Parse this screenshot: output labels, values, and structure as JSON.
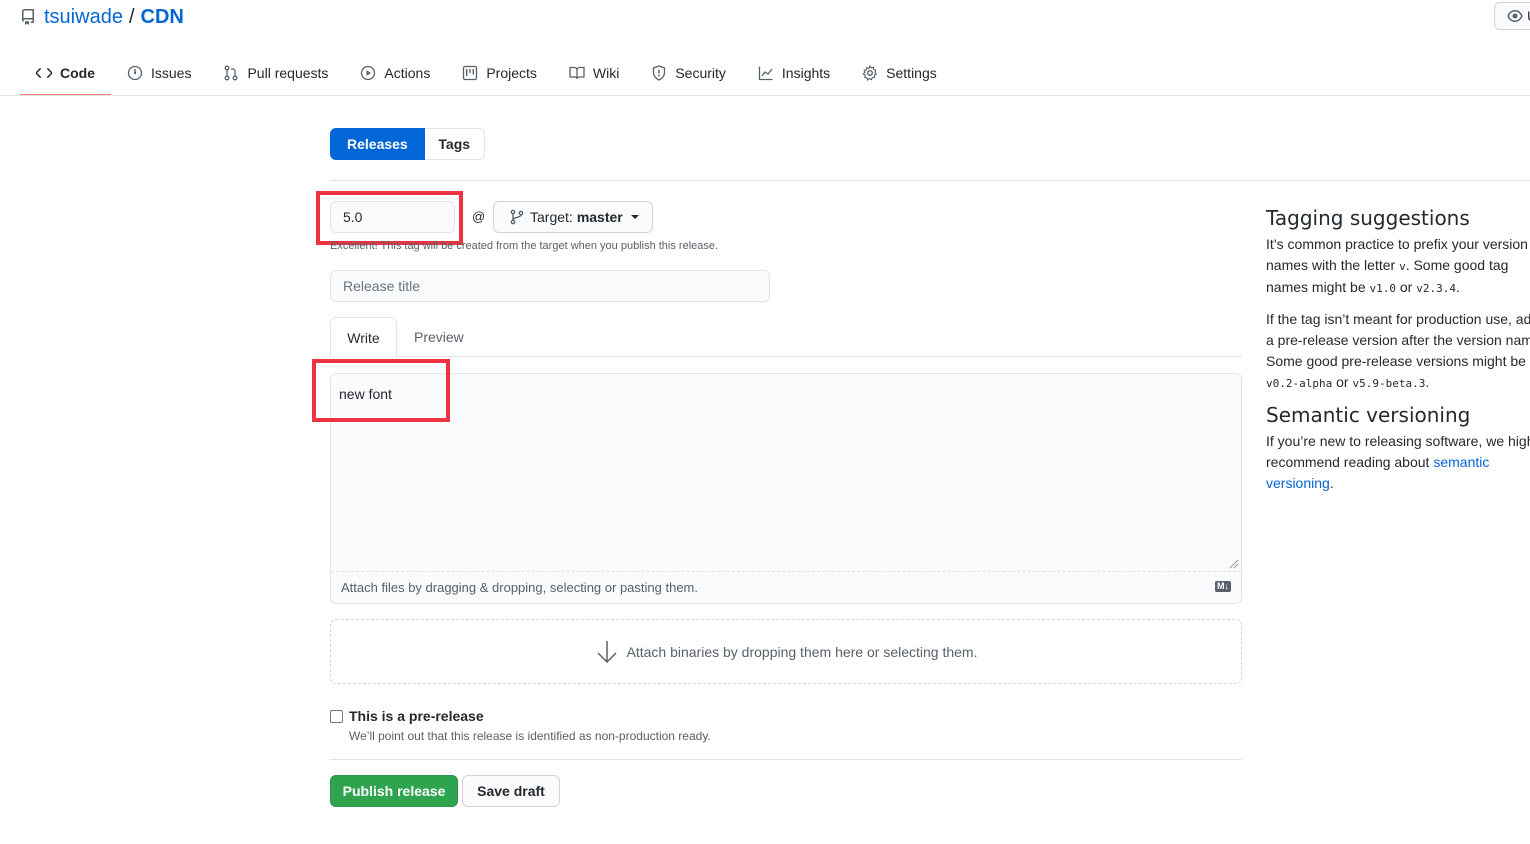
{
  "repo": {
    "owner": "tsuiwade",
    "slash": "/",
    "name": "CDN",
    "watch_label": "U"
  },
  "nav": {
    "tabs": [
      {
        "label": "Code",
        "icon": "code-icon"
      },
      {
        "label": "Issues",
        "icon": "issue-icon"
      },
      {
        "label": "Pull requests",
        "icon": "pull-request-icon"
      },
      {
        "label": "Actions",
        "icon": "play-icon"
      },
      {
        "label": "Projects",
        "icon": "project-icon"
      },
      {
        "label": "Wiki",
        "icon": "book-icon"
      },
      {
        "label": "Security",
        "icon": "shield-icon"
      },
      {
        "label": "Insights",
        "icon": "graph-icon"
      },
      {
        "label": "Settings",
        "icon": "gear-icon"
      }
    ],
    "active_tab": "Code"
  },
  "subnav": {
    "releases": "Releases",
    "tags": "Tags"
  },
  "form": {
    "tag_value": "5.0",
    "at": "@",
    "target_prefix": "Target:",
    "target_branch": "master",
    "tag_note": "Excellent! This tag will be created from the target when you publish this release.",
    "title_placeholder": "Release title",
    "write_tab": "Write",
    "preview_tab": "Preview",
    "body_value": "new font",
    "attach_files": "Attach files by dragging & dropping, selecting or pasting them.",
    "markdown_badge": "M↓",
    "attach_binaries": "Attach binaries by dropping them here or selecting them.",
    "prerelease_label": "This is a pre-release",
    "prerelease_note": "We’ll point out that this release is identified as non-production ready.",
    "publish_button": "Publish release",
    "draft_button": "Save draft"
  },
  "sidebar": {
    "tagging_title": "Tagging suggestions",
    "tagging_p1_a": "It’s common practice to prefix your version names with the letter ",
    "tagging_p1_v": "v",
    "tagging_p1_b": ". Some good tag names might be ",
    "tagging_p1_c1": "v1.0",
    "tagging_p1_or": " or ",
    "tagging_p1_c2": "v2.3.4",
    "tagging_p1_end": ".",
    "tagging_p2_a": "If the tag isn’t meant for production use, add a pre-release version after the version name. Some good pre-release versions might be ",
    "tagging_p2_c1": "v0.2-alpha",
    "tagging_p2_or": " or ",
    "tagging_p2_c2": "v5.9-beta.3",
    "tagging_p2_end": ".",
    "semver_title": "Semantic versioning",
    "semver_text": "If you’re new to releasing software, we highly recommend reading about ",
    "semver_link": "semantic versioning",
    "semver_end": "."
  },
  "colors": {
    "accent": "#0366d6",
    "active_tab_underline": "#f9826c",
    "publish": "#2ea44f",
    "highlight_box": "#ee3340"
  }
}
